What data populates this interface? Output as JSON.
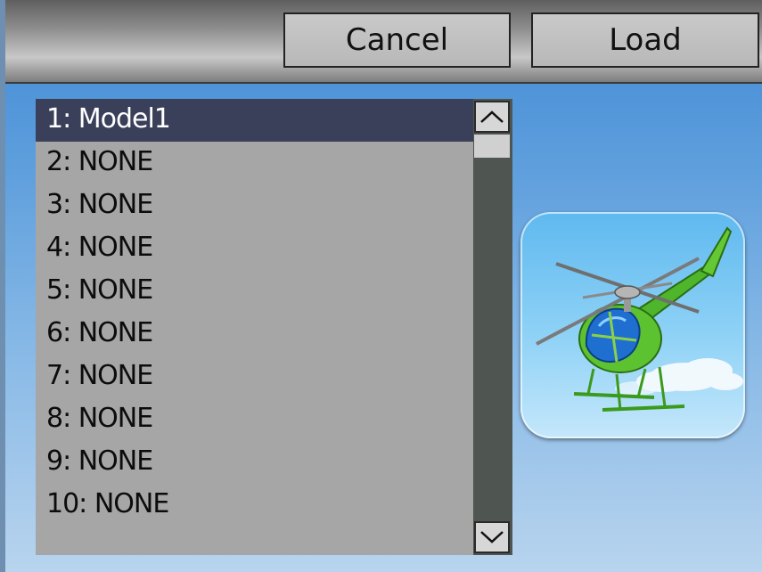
{
  "toolbar": {
    "cancel_label": "Cancel",
    "load_label": "Load"
  },
  "model_list": {
    "selected_index": 0,
    "items": [
      {
        "label": "1: Model1"
      },
      {
        "label": "2: NONE"
      },
      {
        "label": "3: NONE"
      },
      {
        "label": "4: NONE"
      },
      {
        "label": "5: NONE"
      },
      {
        "label": "6: NONE"
      },
      {
        "label": "7: NONE"
      },
      {
        "label": "8: NONE"
      },
      {
        "label": "9: NONE"
      },
      {
        "label": "10: NONE"
      }
    ]
  },
  "scrollbar": {
    "up_icon": "chevron-up-icon",
    "down_icon": "chevron-down-icon"
  },
  "preview": {
    "icon": "helicopter-icon"
  },
  "colors": {
    "selected_row": "#3a3f5a",
    "list_bg": "#a6a6a6",
    "scroll_track": "#4f5550"
  }
}
